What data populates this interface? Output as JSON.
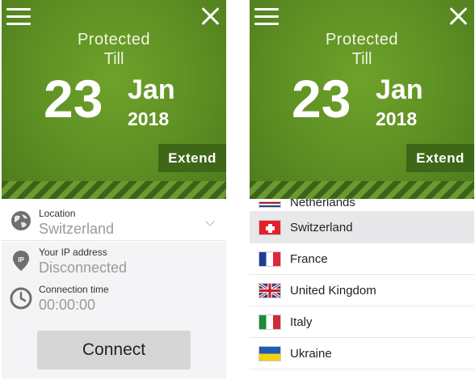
{
  "left_panel": {
    "protected_label": "Protected",
    "till_label": "Till",
    "date_day": "23",
    "date_month": "Jan",
    "date_year": "2018",
    "extend_label": "Extend",
    "location": {
      "label": "Location",
      "value": "Switzerland"
    },
    "ip": {
      "label": "Your IP address",
      "value": "Disconnected",
      "icon_text": "IP"
    },
    "time": {
      "label": "Connection time",
      "value": "00:00:00"
    },
    "connect_label": "Connect"
  },
  "right_panel": {
    "protected_label": "Protected",
    "till_label": "Till",
    "date_day": "23",
    "date_month": "Jan",
    "date_year": "2018",
    "extend_label": "Extend",
    "countries": [
      {
        "name": "Netherlands",
        "flag": "nl-flag-icon",
        "selected": false,
        "partial": true
      },
      {
        "name": "Switzerland",
        "flag": "ch-flag-icon",
        "selected": true
      },
      {
        "name": "France",
        "flag": "fr-flag-icon",
        "selected": false
      },
      {
        "name": "United Kingdom",
        "flag": "uk-flag-icon",
        "selected": false
      },
      {
        "name": "Italy",
        "flag": "it-flag-icon",
        "selected": false
      },
      {
        "name": "Ukraine",
        "flag": "ua-flag-icon",
        "selected": false
      }
    ]
  },
  "colors": {
    "brand_green": "#5d8e23",
    "extend_bg": "#3e6718",
    "selected_row": "#e8e8ea"
  }
}
